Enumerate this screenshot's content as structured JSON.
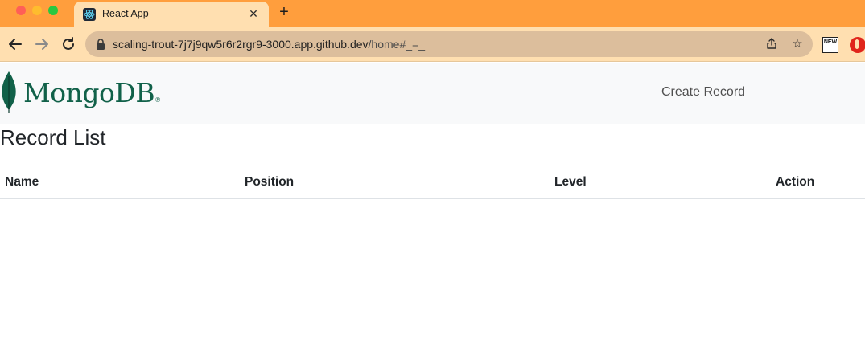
{
  "browser": {
    "tab_title": "React App",
    "tab_icon": "react-icon",
    "url_host": "scaling-trout-7j7j9qw5r6r2rgr9-3000.app.github.dev",
    "url_path": "/home#_=_",
    "news_extension_label": "NEW",
    "colors": {
      "tabstrip": "#ff9e3d",
      "toolbar": "#ffdfb0"
    }
  },
  "page": {
    "logo_text": "MongoDB",
    "logo_registered": "®",
    "nav_link": "Create Record",
    "title": "Record List",
    "table": {
      "columns": [
        "Name",
        "Position",
        "Level",
        "Action"
      ],
      "rows": []
    },
    "colors": {
      "brand_green": "#116149",
      "leaf_green": "#13aa52",
      "navbar_bg": "#f8f9fa"
    }
  }
}
